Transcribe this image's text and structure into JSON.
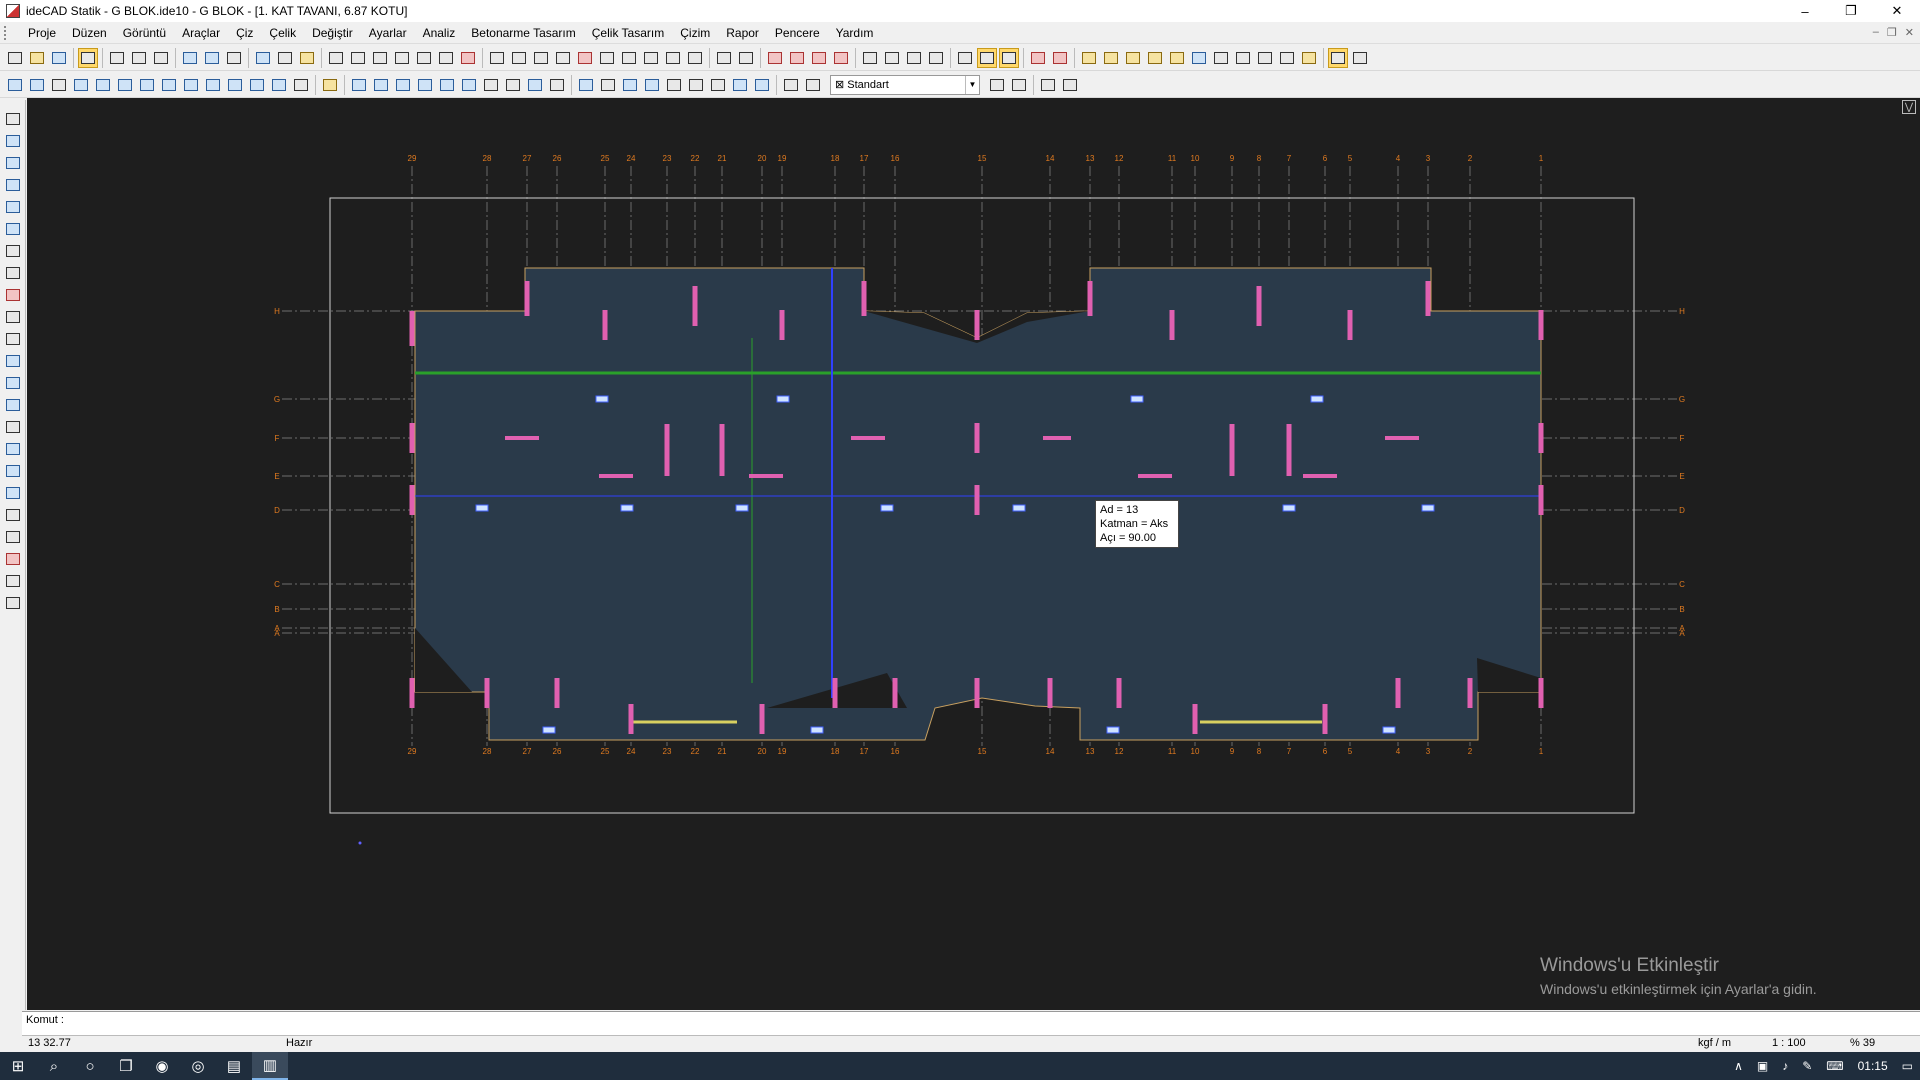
{
  "window": {
    "title": "ideCAD Statik - G BLOK.ide10 - G BLOK - [1. KAT TAVANI,  6.87 KOTU]",
    "minimize": "–",
    "restore": "❐",
    "close": "✕"
  },
  "menu": [
    "Proje",
    "Düzen",
    "Görüntü",
    "Araçlar",
    "Çiz",
    "Çelik",
    "Değiştir",
    "Ayarlar",
    "Analiz",
    "Betonarme Tasarım",
    "Çelik Tasarım",
    "Çizim",
    "Rapor",
    "Pencere",
    "Yardım"
  ],
  "mdi_controls": [
    "–",
    "❐",
    "✕"
  ],
  "toolbar": {
    "layer_value": "Standart",
    "layer_dropdown": "▼"
  },
  "canvas": {
    "corner": "⋁",
    "top_axes": [
      "29",
      "28",
      "27",
      "26",
      "25",
      "24",
      "23",
      "22",
      "21",
      "20",
      "19",
      "18",
      "17",
      "16",
      "15",
      "14",
      "13",
      "12",
      "11",
      "10",
      "9",
      "8",
      "7",
      "6",
      "5",
      "4",
      "3",
      "2",
      "1"
    ],
    "side_axes": [
      "H",
      "G",
      "F",
      "E",
      "D",
      "C",
      "B",
      "A",
      "A"
    ]
  },
  "tooltip": {
    "line1": "Ad = 13",
    "line2": "Katman = Aks",
    "line3": "Açı = 90.00"
  },
  "watermark": {
    "line1": "Windows'u Etkinleştir",
    "line2": "Windows'u etkinleştirmek için Ayarlar'a gidin."
  },
  "command": {
    "label": "Komut :"
  },
  "status": {
    "coords": "13 32.77",
    "state": "Hazır",
    "unit": "kgf / m",
    "scale": "1 : 100",
    "zoom": "% 39"
  },
  "taskbar": {
    "time": "01:15"
  },
  "colors": {
    "canvas_bg": "#1e1e1e",
    "slab_fill": "#2a3a4a",
    "axis_label": "#e07a20",
    "wall_pink": "#e060b0",
    "beam_green": "#2aa02a",
    "beam_blue": "#3040ff"
  }
}
